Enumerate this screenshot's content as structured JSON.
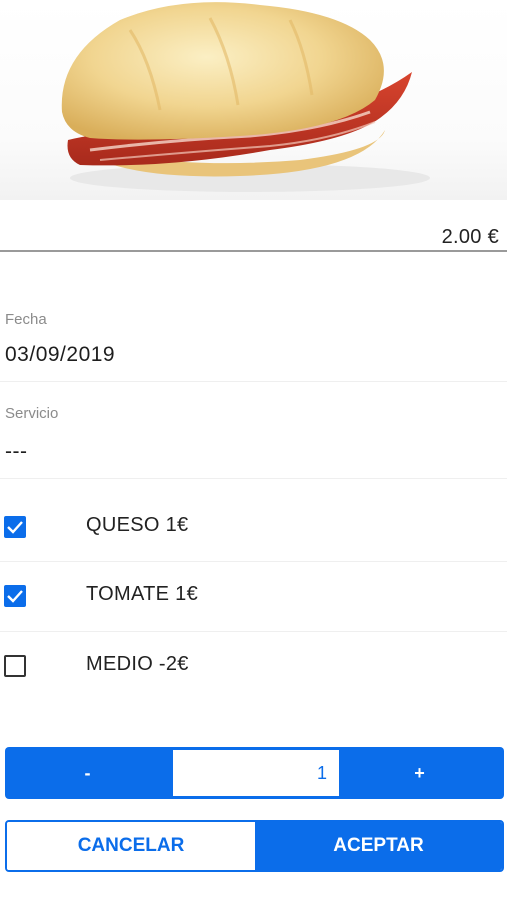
{
  "product": {
    "image_alt": "sandwich-photo",
    "price": "2.00 €"
  },
  "form": {
    "fecha_label": "Fecha",
    "fecha_value": "03/09/2019",
    "servicio_label": "Servicio",
    "servicio_value": "---"
  },
  "extras": [
    {
      "label": "QUESO 1€",
      "checked": true
    },
    {
      "label": "TOMATE 1€",
      "checked": true
    },
    {
      "label": "MEDIO -2€",
      "checked": false
    }
  ],
  "quantity": {
    "minus_label": "-",
    "value": "1",
    "plus_label": "+"
  },
  "actions": {
    "cancel_label": "CANCELAR",
    "accept_label": "ACEPTAR"
  },
  "colors": {
    "accent": "#0b6dea",
    "text": "#222222",
    "label": "#8b8b8b"
  }
}
